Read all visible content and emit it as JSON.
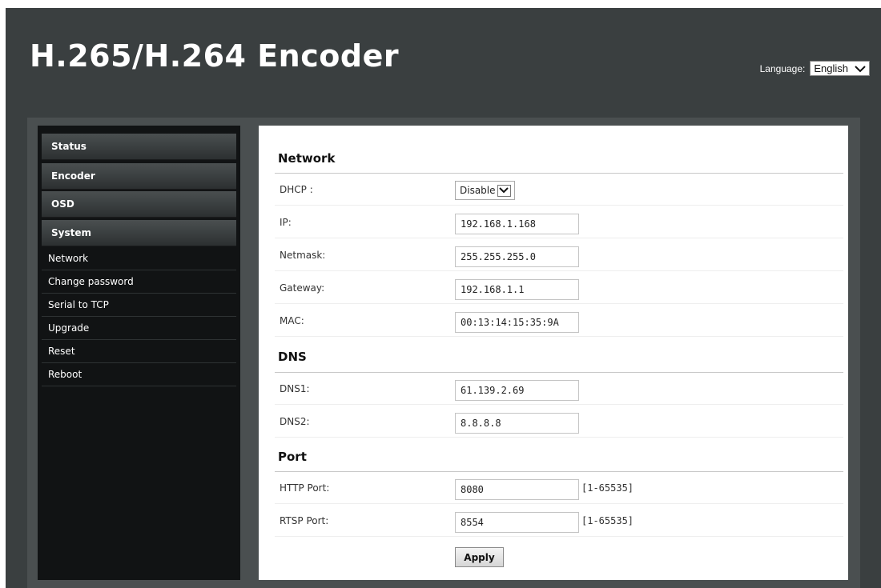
{
  "header": {
    "title": "H.265/H.264 Encoder",
    "language_label": "Language:",
    "language_value": "English"
  },
  "sidebar": {
    "menus": [
      {
        "label": "Status"
      },
      {
        "label": "Encoder"
      },
      {
        "label": "OSD"
      },
      {
        "label": "System"
      }
    ],
    "system_items": [
      {
        "label": "Network"
      },
      {
        "label": "Change password"
      },
      {
        "label": "Serial to TCP"
      },
      {
        "label": "Upgrade"
      },
      {
        "label": "Reset"
      },
      {
        "label": "Reboot"
      }
    ]
  },
  "network": {
    "title": "Network",
    "dhcp_label": "DHCP :",
    "dhcp_value": "Disable",
    "ip_label": "IP:",
    "ip_value": "192.168.1.168",
    "netmask_label": "Netmask:",
    "netmask_value": "255.255.255.0",
    "gateway_label": "Gateway:",
    "gateway_value": "192.168.1.1",
    "mac_label": "MAC:",
    "mac_value": "00:13:14:15:35:9A"
  },
  "dns": {
    "title": "DNS",
    "dns1_label": "DNS1:",
    "dns1_value": "61.139.2.69",
    "dns2_label": "DNS2:",
    "dns2_value": "8.8.8.8"
  },
  "port": {
    "title": "Port",
    "http_label": "HTTP Port:",
    "http_value": "8080",
    "http_range": "[1-65535]",
    "rtsp_label": "RTSP Port:",
    "rtsp_value": "8554",
    "rtsp_range": "[1-65535]"
  },
  "apply_label": "Apply",
  "icons": {
    "dropdown": "chevron-down-icon"
  },
  "colors": {
    "frame_bg": "#3a3f40",
    "sidebar_bg": "#111314",
    "content_bg": "#ffffff"
  }
}
